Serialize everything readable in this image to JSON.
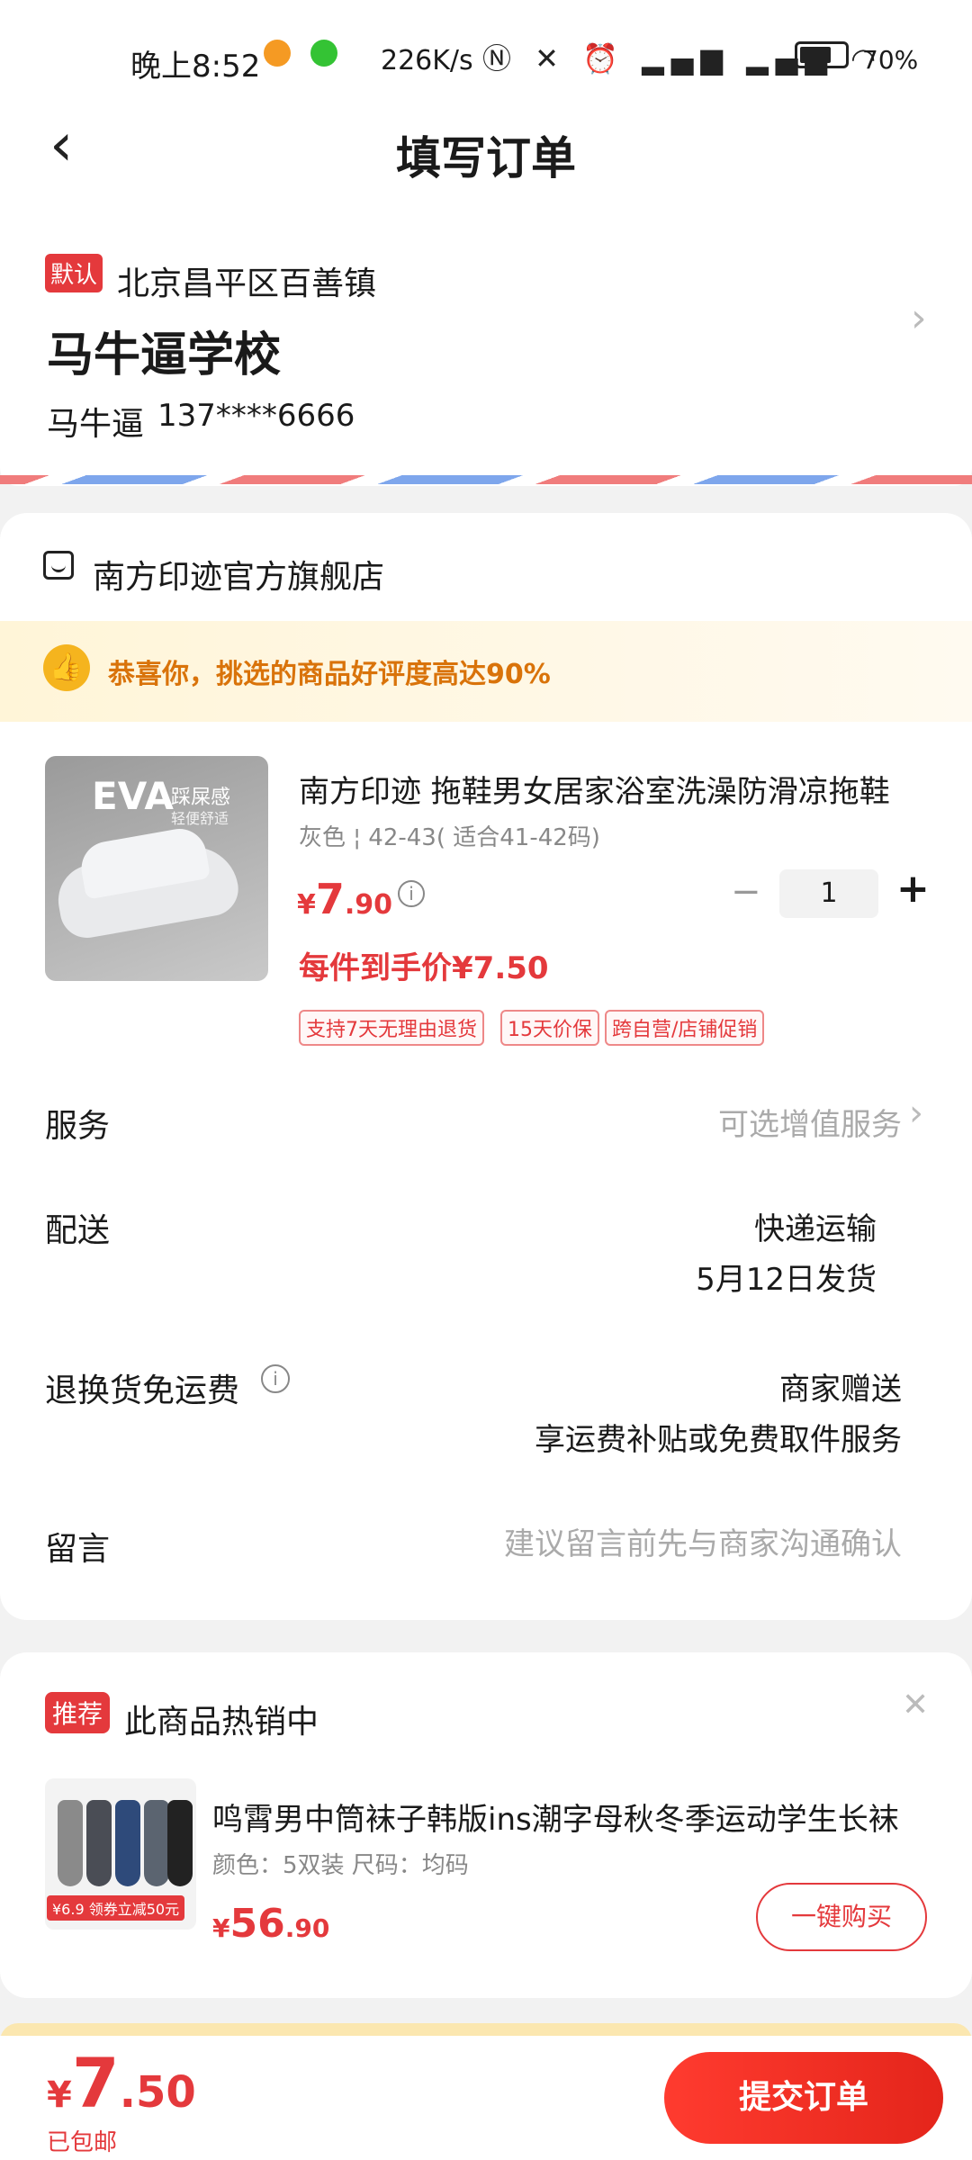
{
  "status_bar": {
    "time": "晚上8:52",
    "speed": "226K/s",
    "battery": "70%",
    "battery_level": 0.7
  },
  "header": {
    "title": "填写订单"
  },
  "address": {
    "tag": "默认",
    "region": "北京昌平区百善镇",
    "detail": "马牛逼学校",
    "name": "马牛逼",
    "phone": "137****6666"
  },
  "store": {
    "name": "南方印迹官方旗舰店"
  },
  "promo": {
    "text": "恭喜你，挑选的商品好评度高达90%"
  },
  "product": {
    "image_text": "EVA",
    "image_sub": "踩屎感",
    "image_sub2": "轻便舒适",
    "title": "南方印迹 拖鞋男女居家浴室洗澡防滑凉拖鞋",
    "spec": "灰色 ¦ 42-43( 适合41-42码)",
    "currency": "¥",
    "price_int": "7",
    "price_dec": ".90",
    "quantity": "1",
    "final_price": "每件到手价¥7.50",
    "badges": [
      "支持7天无理由退货",
      "15天价保",
      "跨自营/店铺促销"
    ]
  },
  "rows": {
    "service_label": "服务",
    "service_value": "可选增值服务",
    "delivery_label": "配送",
    "delivery_value": "快递运输",
    "delivery_date": "5月12日发货",
    "return_label": "退换货免运费",
    "return_value": "商家赠送",
    "return_desc": "享运费补贴或免费取件服务",
    "note_label": "留言",
    "note_placeholder": "建议留言前先与商家沟通确认"
  },
  "recommend": {
    "tag": "推荐",
    "title": "此商品热销中",
    "image_badge": "¥6.9 领券立减50元",
    "name": "鸣霄男中筒袜子韩版ins潮字母秋冬季运动学生长袜",
    "spec": "颜色：5双装    尺码：均码",
    "currency": "¥",
    "price_int": "56",
    "price_dec": ".90",
    "buy_label": "一键购买"
  },
  "bottom": {
    "currency": "¥",
    "total_int": "7",
    "total_dec": ".50",
    "shipping_note": "已包邮",
    "submit_label": "提交订单"
  },
  "colors": {
    "accent": "#e4393c",
    "promo_text": "#d9730a"
  }
}
